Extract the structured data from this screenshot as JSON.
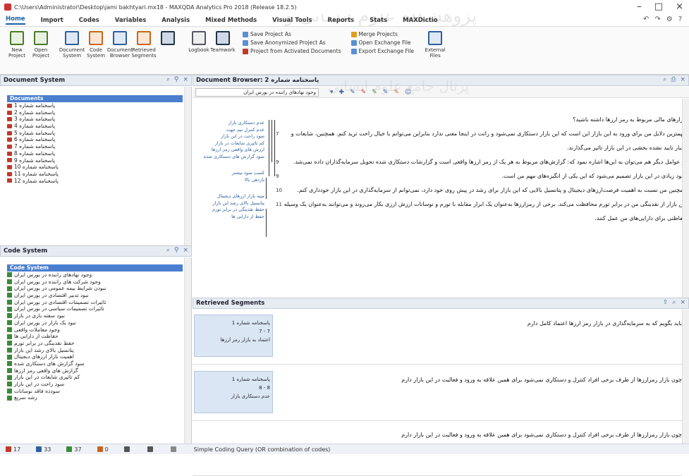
{
  "window": {
    "title": "C:\\Users\\Administrator\\Desktop\\jami bakhtyari.mx18 - MAXQDA Analytics Pro 2018 (Release 18.2.5)",
    "controls": [
      "–",
      "□",
      "×"
    ]
  },
  "watermark": {
    "line1": "پژوهشگاه علوم انسانی و مطالعات فرهنگی",
    "line2": "پرتال جامع علوم انسانی"
  },
  "menu": {
    "items": [
      "Home",
      "Import",
      "Codes",
      "Variables",
      "Analysis",
      "Mixed Methods",
      "Visual Tools",
      "Reports",
      "Stats",
      "MAXDictio"
    ],
    "active": "Home"
  },
  "ribbon": {
    "big_buttons": [
      {
        "label": "New Project",
        "icon": "new-project-icon"
      },
      {
        "label": "Open Project",
        "icon": "open-project-icon"
      },
      {
        "label": "Document System",
        "icon": "document-system-icon"
      },
      {
        "label": "Code System",
        "icon": "code-system-icon"
      },
      {
        "label": "Document Browser",
        "icon": "document-browser-icon"
      },
      {
        "label": "Retrieved Segments",
        "icon": "retrieved-segments-icon"
      },
      {
        "label": "Logbook",
        "icon": "logbook-icon"
      },
      {
        "label": "Teamwork",
        "icon": "teamwork-icon"
      },
      {
        "label": "External Files",
        "icon": "external-files-icon"
      }
    ],
    "small_col1": [
      "Save Project As",
      "Save Anonymized Project As",
      "Project from Activated Documents"
    ],
    "small_col2": [
      "Merge Projects",
      "Open Exchange File",
      "Export Exchange File"
    ]
  },
  "document_system": {
    "title": "Document System",
    "root": "Documents",
    "items": [
      "پاسخنامه شماره 1",
      "پاسخنامه شماره 2",
      "پاسخنامه شماره 3",
      "پاسخنامه شماره 4",
      "پاسخنامه شماره 5",
      "پاسخنامه شماره 6",
      "پاسخنامه شماره 7",
      "پاسخنامه شماره 8",
      "پاسخنامه شماره 9",
      "پاسخنامه شماره 10",
      "پاسخنامه شماره 11",
      "پاسخنامه شماره 12"
    ]
  },
  "code_system": {
    "title": "Code System",
    "root": "Code System",
    "items": [
      "وجود نهادهای راننده در بورس ایران",
      "وجود شرکت های راننده در بورس ایران",
      "نبودن شرایط بیمه عمومی در بورس ایران",
      "نبود تدبیر اقتصادی در بورس ایران",
      "تاثیرات تصمیمات اقتصادی در بورس ایران",
      "تاثیرات تصمیمات سیاسی در بورس ایران",
      "نبود سفته بازی در بازار",
      "نبود یک بازار در بورس ایران",
      "وجود معاملات واقعی",
      "حفاظت از دارایی ها",
      "حفظ نقدینگی در برابر تورم",
      "پتانسیل بالای رشد این بازار",
      "اهمیت بازار ارزهای دیجیتال",
      "سود گزارش های دستکاری شده",
      "گزارش های واقعی رمز ارزها",
      "کم تاثیری شایعات در این بازار",
      "سود راحت در این بازار",
      "سودده فاقد نوسانات",
      "رشد سریع"
    ]
  },
  "document_browser": {
    "title": "Document Browser: پاسخنامه شماره 2",
    "selected_code": "وجود نهادهای راننده در بورس ایران",
    "code_labels": [
      "عدم دستکاری بازار",
      "عدم کنترل نیم جهت",
      "سود راحت در این بازار",
      "کم تاثیری شایعات در بازار",
      "ارزش های واقعی رمز ارزها",
      "سود گزارش های دستکاری شده",
      "کسب سود بیشتر",
      "بازدهی بالا",
      "مینه بازار ارزهای دیجیتال",
      "پتانسیل بالای رشد این بازار",
      "حفظ نقدینگی در برابر تورم",
      "حفظ از دارایی ها"
    ],
    "paragraphs": [
      {
        "num": "",
        "text": "بازارهای مالی مربوط به رمز ارزها داشته باشید؟"
      },
      {
        "num": "7",
        "text": "مهمترین دلایل من برای ورود به این بازار این است که این بازار دستکاری نمی‌شود و رانت در اینجا معنی ندارد بنابراین می‌توانم با خیال راحت ترید کنم. همچنین، شایعات و اخبار تایید نشده بخشی در این بازار تاثیر می‌گذارند."
      },
      {
        "num": "9",
        "text": "از عوامل دیگر هم می‌توان به این‌ها اشاره نمود که: گزارش‌های مربوط به هر یک از رمز ارزها واقعی است و گزارشات دستکاری شده تحویل سرمایه‌گذاران داده نمی‌شد."
      },
      {
        "num": "9",
        "text": "سود زیادی در این بازار تصمیم می‌شود که این یکی از انگیزه‌های مهم من است."
      },
      {
        "num": "10",
        "text": "همچنین من نسبت به اهمیت فرصت‌ارزهای دیجیتال و پتانسیل بالایی که این بازار برای رشد در پیش روی خود دارد، نمی‌توانم از سرمایه‌گذاری در این بازار خودداری کنم."
      },
      {
        "num": "11",
        "text": "این بازار از نقدینگی من در برابر تورم محافظت می‌کند. برخی از رمزارزها به‌عنوان یک ابزار مقابله با تورم و نوسانات ارزش ارزی بکار می‌روند و می‌توانند به‌عنوان یک وسیله حفاظتی برای دارایی‌های من عمل کنند."
      }
    ]
  },
  "retrieved_segments": {
    "title": "Retrieved Segments",
    "segments": [
      {
        "doc": "پاسخنامه شماره 1",
        "range": "7 - 7",
        "code": "اعتماد به بازار رمز ارزها",
        "text": "باید بگویم که به سرمایه‌گذاری در بازار رمز ارزها اعتماد کامل دارم"
      },
      {
        "doc": "پاسخنامه شماره 1",
        "range": "8 - 8",
        "code": "عدم دستکاری بازار",
        "text": "چون بازار رمزارزها از طرف برخی افراد کنترل و دستکاری نمی‌شود برای همین علاقه به ورود و فعالیت در این بازار دارم"
      },
      {
        "doc": "",
        "range": "",
        "code": "",
        "text": "چون بازار رمزارزها از طرف برخی افراد کنترل و دستکاری نمی‌شود برای همین علاقه به ورود و فعالیت در این بازار دارم"
      }
    ]
  },
  "status": {
    "items": [
      {
        "value": "17",
        "color": "#c0392b"
      },
      {
        "value": "33",
        "color": "#2f5f9f"
      },
      {
        "value": "37",
        "color": "#3a8a3a"
      },
      {
        "value": "0",
        "color": "#c8651a"
      },
      {
        "value": "",
        "color": "#555"
      },
      {
        "value": "",
        "color": "#555"
      },
      {
        "value": "",
        "color": "#888"
      }
    ],
    "query": "Simple Coding Query (OR combination of codes)"
  }
}
